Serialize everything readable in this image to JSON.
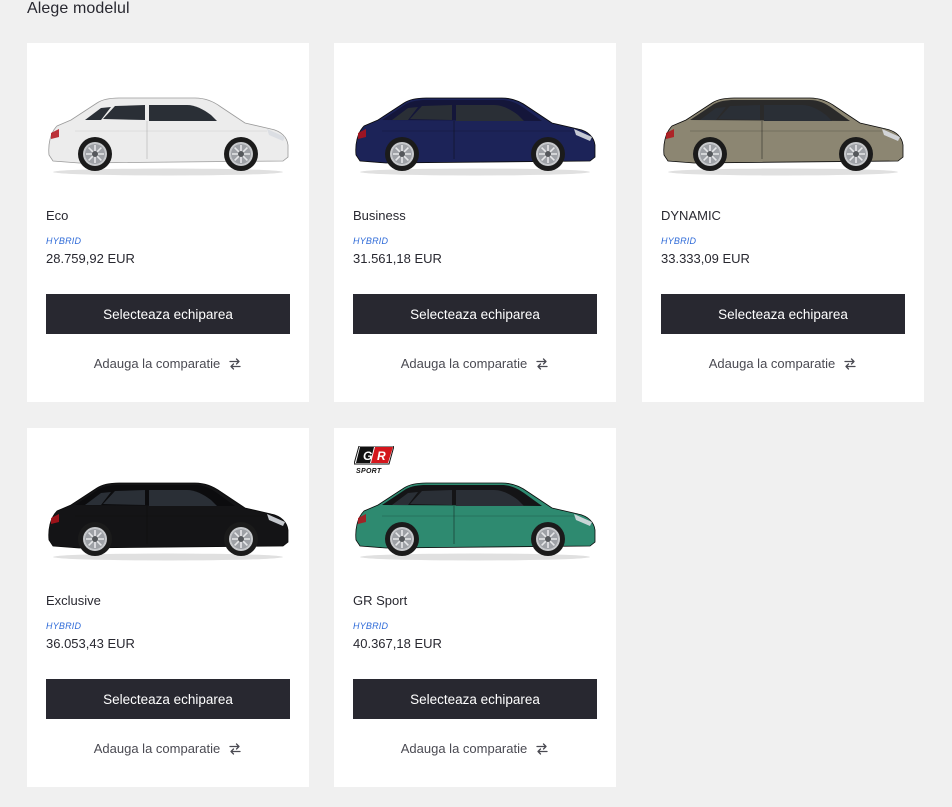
{
  "page": {
    "title": "Alege modelul"
  },
  "cards": [
    {
      "name": "Eco",
      "tag": "HYBRID",
      "price": "28.759,92 EUR",
      "select_label": "Selecteaza echiparea",
      "compare_label": "Adauga la comparatie",
      "car_color": "#ececec",
      "car_roof": "#ececec",
      "badge": ""
    },
    {
      "name": "Business",
      "tag": "HYBRID",
      "price": "31.561,18 EUR",
      "select_label": "Selecteaza echiparea",
      "compare_label": "Adauga la comparatie",
      "car_color": "#1c2358",
      "car_roof": "#14163a",
      "badge": ""
    },
    {
      "name": "DYNAMIC",
      "tag": "HYBRID",
      "price": "33.333,09 EUR",
      "select_label": "Selecteaza echiparea",
      "compare_label": "Adauga la comparatie",
      "car_color": "#8c8672",
      "car_roof": "#2a2a2a",
      "badge": ""
    },
    {
      "name": "Exclusive",
      "tag": "HYBRID",
      "price": "36.053,43 EUR",
      "select_label": "Selecteaza echiparea",
      "compare_label": "Adauga la comparatie",
      "car_color": "#141416",
      "car_roof": "#0c0c0e",
      "badge": ""
    },
    {
      "name": "GR Sport",
      "tag": "HYBRID",
      "price": "40.367,18 EUR",
      "select_label": "Selecteaza echiparea",
      "compare_label": "Adauga la comparatie",
      "car_color": "#2e8a70",
      "car_roof": "#141416",
      "badge": "GR SPORT"
    }
  ],
  "colors": {
    "button_bg": "#282830",
    "hybrid_text": "#2f6bd8",
    "page_bg": "#f0f0f0"
  },
  "icons": {
    "compare": "swap-arrows-icon",
    "badge": "gr-sport-logo-icon"
  }
}
